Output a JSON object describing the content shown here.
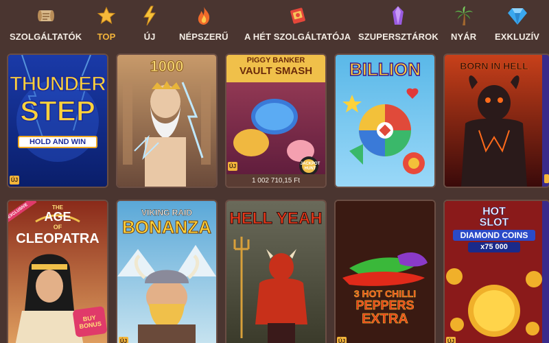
{
  "nav": {
    "items": [
      {
        "label": "SZOLGÁLTATÓK",
        "icon": "scroll-icon"
      },
      {
        "label": "TOP",
        "icon": "star-icon"
      },
      {
        "label": "ÚJ",
        "icon": "lightning-icon"
      },
      {
        "label": "NÉPSZERŰ",
        "icon": "fire-icon"
      },
      {
        "label": "A HÉT SZOLGÁLTATÓJA",
        "icon": "ticket-icon"
      },
      {
        "label": "SZUPERSZTÁROK",
        "icon": "crystal-icon"
      },
      {
        "label": "NYÁR",
        "icon": "palm-tree-icon"
      },
      {
        "label": "EXKLUZÍV",
        "icon": "diamond-icon"
      }
    ],
    "active": "TOP"
  },
  "games": {
    "row1": [
      {
        "title_line1": "THUNDER",
        "title_line2": "STEP",
        "subtitle": "HOLD AND WIN",
        "badge": "ÚJ"
      },
      {
        "title_line1": "1000",
        "badge": ""
      },
      {
        "title_line1": "PIGGY BANKER",
        "title_line2": "VAULT SMASH",
        "corner": "JACKPOT HUNT",
        "jackpot": "1 002 710,15 Ft",
        "badge": "ÚJ"
      },
      {
        "title_line1": "BILLION",
        "badge": ""
      },
      {
        "title_line1": "BORN IN HELL",
        "badge": ""
      }
    ],
    "row2": [
      {
        "title_line1": "THE",
        "title_line2": "AGE",
        "title_line3": "OF",
        "title_line4": "CLEOPATRA",
        "ribbon": "EXCLUSIVE",
        "bonus": "BUY BONUS"
      },
      {
        "title_line1": "VIKING RAID",
        "title_line2": "BONANZA",
        "badge": "ÚJ"
      },
      {
        "title_line1": "HELL YEAH"
      },
      {
        "title_line1": "3 HOT CHILLI",
        "title_line2": "PEPPERS",
        "title_line3": "EXTRA",
        "badge": "ÚJ"
      },
      {
        "title_line1": "HOT",
        "title_line2": "SLOT",
        "title_line3": "DIAMOND COINS",
        "multiplier": "x75 000",
        "badge": "ÚJ"
      }
    ]
  },
  "colors": {
    "background": "#4a3530",
    "active_nav": "#f4b43a",
    "nav_text": "#f3ece4",
    "badge": "#f3b53a"
  }
}
